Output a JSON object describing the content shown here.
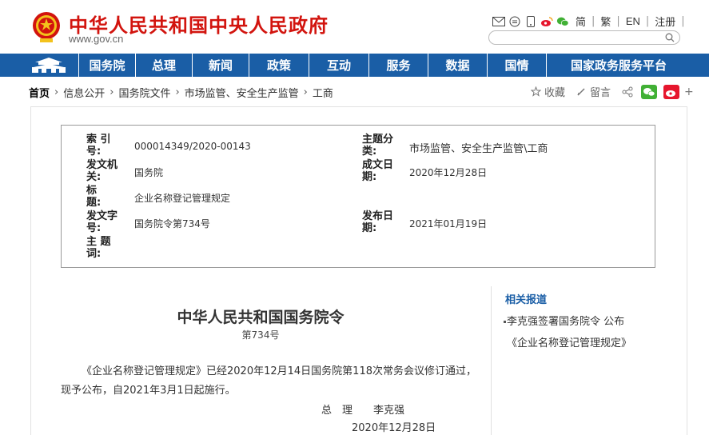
{
  "header": {
    "title": "中华人民共和国中央人民政府",
    "url": "www.gov.cn",
    "links": {
      "simplified": "简",
      "traditional": "繁",
      "english": "EN",
      "register": "注册"
    },
    "search": {
      "placeholder": ""
    }
  },
  "nav": {
    "items": [
      "国务院",
      "总理",
      "新闻",
      "政策",
      "互动",
      "服务",
      "数据",
      "国情",
      "国家政务服务平台"
    ]
  },
  "breadcrumb": [
    "首页",
    "信息公开",
    "国务院文件",
    "市场监管、安全生产监管",
    "工商"
  ],
  "tools": {
    "collect": "收藏",
    "comment": "留言"
  },
  "meta": {
    "index_label": "索 引 号:",
    "index_value": "000014349/2020-00143",
    "category_label": "主题分类:",
    "category_value": "市场监管、安全生产监管\\工商",
    "issuer_label": "发文机关:",
    "issuer_value": "国务院",
    "written_label": "成文日期:",
    "written_value": "2020年12月28日",
    "title_label": "标　　题:",
    "title_value": "企业名称登记管理规定",
    "docno_label": "发文字号:",
    "docno_value": "国务院令第734号",
    "published_label": "发布日期:",
    "published_value": "2021年01月19日",
    "keywords_label": "主 题 词:"
  },
  "article": {
    "title": "中华人民共和国国务院令",
    "number": "第734号",
    "body": "《企业名称登记管理规定》已经2020年12月14日国务院第118次常务会议修订通过，现予公布，自2021年3月1日起施行。",
    "sign": "总　理　　李克强",
    "date": "2020年12月28日"
  },
  "related": {
    "heading": "相关报道",
    "items": [
      "李克强签署国务院令 公布《企业名称登记管理规定》"
    ]
  },
  "colors": {
    "brand_red": "#d2140e",
    "nav_blue": "#1a5ea6"
  }
}
